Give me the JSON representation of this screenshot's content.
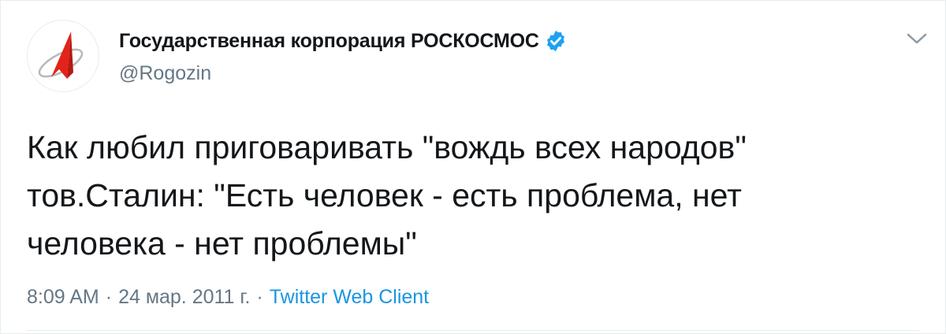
{
  "tweet": {
    "display_name": "Государственная корпорация РОСКОСМОС",
    "handle": "@Rogozin",
    "verified": true,
    "avatar_icon": "roscosmos-logo-icon",
    "text": "Как любил приговаривать \"вождь всех народов\"\nтов.Сталин: \"Есть человек - есть проблема, нет\nчеловека - нет проблемы\"",
    "time": "8:09 AM",
    "date": "24 мар. 2011 г.",
    "separator": "·",
    "source": "Twitter Web Client"
  },
  "colors": {
    "text": "#14171a",
    "secondary": "#657786",
    "link": "#1b95e0",
    "verified": "#1da1f2",
    "logo_red": "#e2231a",
    "border": "#e6ecf0"
  }
}
